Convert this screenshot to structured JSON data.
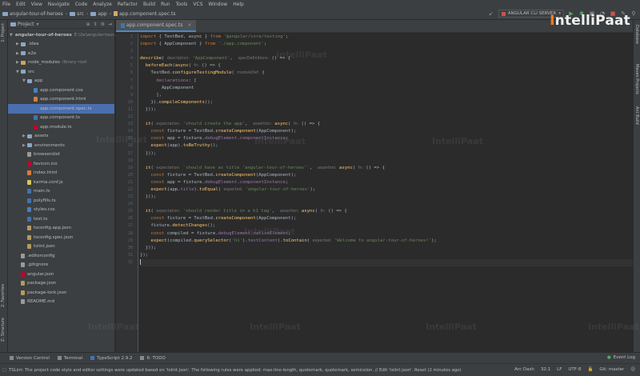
{
  "menubar": {
    "items": [
      "File",
      "Edit",
      "View",
      "Navigate",
      "Code",
      "Analyze",
      "Refactor",
      "Build",
      "Run",
      "Tools",
      "VCS",
      "Window",
      "Help"
    ]
  },
  "navbar": {
    "crumbs": [
      "angular-tour-of-heroes",
      "src",
      "app",
      "app.component.spec.ts"
    ],
    "run_config": "ANGULAR CLI SERVER"
  },
  "left_strip": {
    "project": "1: Project",
    "favorites": "2: Favorites",
    "structure": "Z: Structure"
  },
  "right_strip": {
    "database": "Database",
    "maven": "Maven Projects",
    "ant": "Ant Build"
  },
  "project_panel": {
    "title": "Project",
    "root_label": "angular-tour-of-heroes",
    "root_path": "E:\\2e\\angular-tour...",
    "items": [
      {
        "label": ".idea",
        "icon": "folder",
        "indent": 1,
        "arrow": "▶"
      },
      {
        "label": "e2e",
        "icon": "folder",
        "indent": 1,
        "arrow": "▶"
      },
      {
        "label": "node_modules",
        "icon": "folder-y",
        "indent": 1,
        "arrow": "▶",
        "suffix": "library root"
      },
      {
        "label": "src",
        "icon": "folder",
        "indent": 1,
        "arrow": "▼"
      },
      {
        "label": "app",
        "icon": "folder",
        "indent": 2,
        "arrow": "▼"
      },
      {
        "label": "app.component.css",
        "icon": "css",
        "indent": 3,
        "arrow": ""
      },
      {
        "label": "app.component.html",
        "icon": "html",
        "indent": 3,
        "arrow": ""
      },
      {
        "label": "app.component.spec.ts",
        "icon": "ts",
        "indent": 3,
        "arrow": "",
        "selected": true
      },
      {
        "label": "app.component.ts",
        "icon": "ts",
        "indent": 3,
        "arrow": ""
      },
      {
        "label": "app.module.ts",
        "icon": "ang",
        "indent": 3,
        "arrow": ""
      },
      {
        "label": "assets",
        "icon": "folder",
        "indent": 2,
        "arrow": "▶"
      },
      {
        "label": "environments",
        "icon": "folder",
        "indent": 2,
        "arrow": "▶"
      },
      {
        "label": "browserslist",
        "icon": "gen",
        "indent": 2,
        "arrow": ""
      },
      {
        "label": "favicon.ico",
        "icon": "ang",
        "indent": 2,
        "arrow": ""
      },
      {
        "label": "index.html",
        "icon": "html",
        "indent": 2,
        "arrow": ""
      },
      {
        "label": "karma.conf.js",
        "icon": "js",
        "indent": 2,
        "arrow": ""
      },
      {
        "label": "main.ts",
        "icon": "ts",
        "indent": 2,
        "arrow": ""
      },
      {
        "label": "polyfills.ts",
        "icon": "ts",
        "indent": 2,
        "arrow": ""
      },
      {
        "label": "styles.css",
        "icon": "css",
        "indent": 2,
        "arrow": ""
      },
      {
        "label": "test.ts",
        "icon": "ts",
        "indent": 2,
        "arrow": ""
      },
      {
        "label": "tsconfig.app.json",
        "icon": "json",
        "indent": 2,
        "arrow": ""
      },
      {
        "label": "tsconfig.spec.json",
        "icon": "json",
        "indent": 2,
        "arrow": ""
      },
      {
        "label": "tslint.json",
        "icon": "json",
        "indent": 2,
        "arrow": ""
      },
      {
        "label": ".editorconfig",
        "icon": "gen",
        "indent": 1,
        "arrow": ""
      },
      {
        "label": ".gitignore",
        "icon": "gen",
        "indent": 1,
        "arrow": ""
      },
      {
        "label": "angular.json",
        "icon": "ang",
        "indent": 1,
        "arrow": ""
      },
      {
        "label": "package.json",
        "icon": "json",
        "indent": 1,
        "arrow": ""
      },
      {
        "label": "package-lock.json",
        "icon": "json",
        "indent": 1,
        "arrow": ""
      },
      {
        "label": "README.md",
        "icon": "gen",
        "indent": 1,
        "arrow": ""
      }
    ]
  },
  "editor": {
    "tab_label": "app.component.spec.ts",
    "line_count": 32,
    "current_line": 32
  },
  "bottom_tools": [
    "Version Control",
    "Terminal",
    "TypeScript 2.9.2",
    "6: TODO"
  ],
  "event_log": "Event Log",
  "status": {
    "message": "TSLint: The project code style and editor settings were updated based on 'tslint.json'. The following rules were applied: max-line-length, quotemark, quotemark, semicolon. // Edit 'tslint.json'. Reset (2 minutes ago)",
    "context": "Arc Dash",
    "position": "32:1",
    "line_sep": "LF",
    "encoding": "UTF-8",
    "vcs": "Git: master"
  },
  "brand": {
    "logo_i": "I",
    "logo_rest": "ntelliPaat",
    "watermark": "ntelliPaat"
  }
}
